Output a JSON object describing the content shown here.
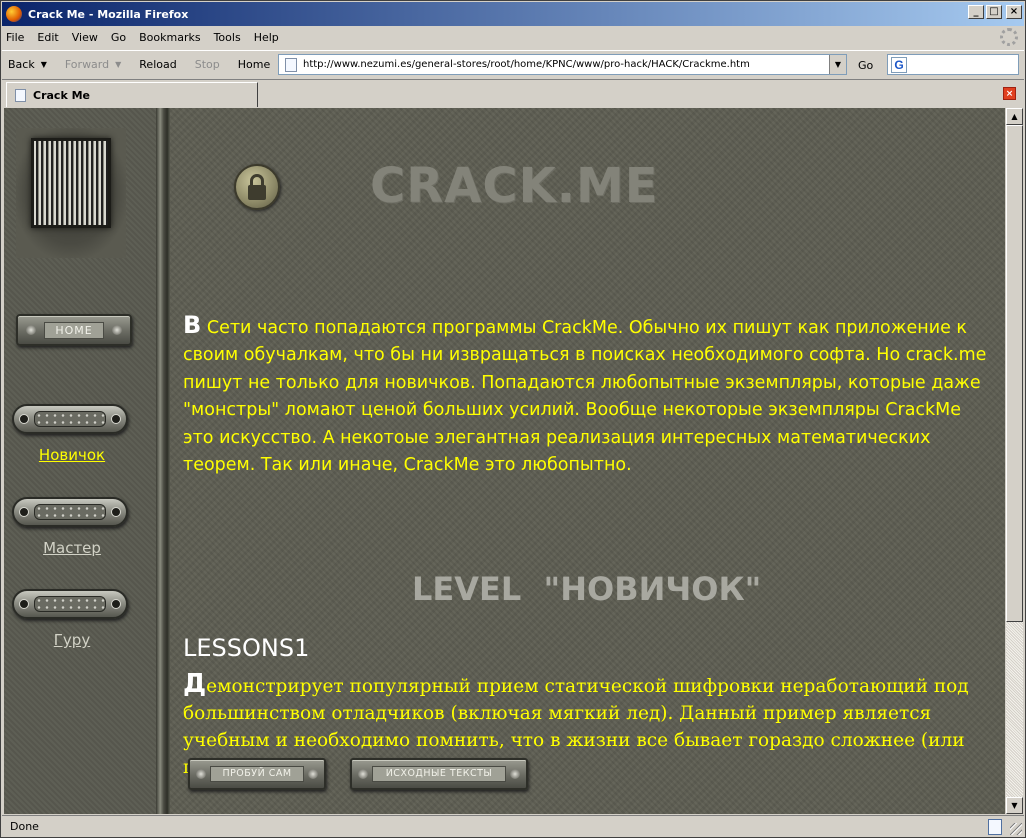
{
  "window": {
    "title": "Crack Me - Mozilla Firefox",
    "controls": {
      "minimize": "_",
      "maximize": "□",
      "close": "×"
    }
  },
  "menu": [
    {
      "label": "File"
    },
    {
      "label": "Edit"
    },
    {
      "label": "View"
    },
    {
      "label": "Go"
    },
    {
      "label": "Bookmarks"
    },
    {
      "label": "Tools"
    },
    {
      "label": "Help"
    }
  ],
  "toolbar": {
    "back": "Back",
    "forward": "Forward",
    "reload": "Reload",
    "stop": "Stop",
    "home": "Home",
    "url": "http://www.nezumi.es/general-stores/root/home/KPNC/www/pro-hack/HACK/Crackme.htm",
    "go": "Go"
  },
  "tab": {
    "title": "Crack Me",
    "close": "×"
  },
  "sidebar": {
    "home_button": "HOME",
    "links": [
      {
        "label": "Новичок",
        "active": true
      },
      {
        "label": "Мастер",
        "active": false
      },
      {
        "label": "Гуру",
        "active": false
      }
    ]
  },
  "page": {
    "heading": "CRACK.ME",
    "intro_dropcap": "В",
    "intro_text": " Сети часто попадаются программы CrackMe. Обычно их пишут как приложение к своим обучалкам, что бы ни извращаться в поисках необходимого софта. Но crack.me пишут не только для новичков. Попадаются любопытные экземпляры, которые даже \"монстры\" ломают ценой больших усилий. Вообще некоторые экземпляры CrackMe это искусство. А некотоые элегантная реализация интересных математических теорем. Так или иначе, CrackMe это любопытно.",
    "level_heading": "LEVEL  \"НОВИЧОК\"",
    "lesson_title": "LESSONS1",
    "lesson_dropcap": "Д",
    "lesson_text": "емонстрирует популярный прием статической шифровки неработающий под большинством отладчиков (включая мягкий лед). Данный пример является учебным и необходимо помнить, что в жизни все бывает гораздо сложнее (или проще)",
    "try_button": "ПРОБУЙ САМ",
    "source_button": "ИСХОДНЫЕ ТЕКСТЫ"
  },
  "status": {
    "text": "Done"
  },
  "colors": {
    "link_active": "#ffff00",
    "body_text": "#ffff00",
    "page_bg": "#5d5d52",
    "heading": "#838379",
    "titlebar_start": "#0a246a",
    "titlebar_end": "#a6caf0"
  },
  "scroll": {
    "thumb_fraction": 0.74
  }
}
